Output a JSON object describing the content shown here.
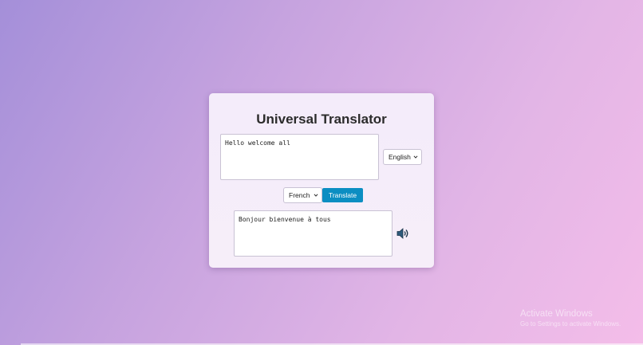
{
  "app": {
    "title": "Universal Translator"
  },
  "source": {
    "text": "Hello welcome all",
    "language": "English"
  },
  "target": {
    "language": "French",
    "text": "Bonjour bienvenue à tous"
  },
  "actions": {
    "translate_label": "Translate",
    "speak_icon": "speaker-icon"
  },
  "watermark": {
    "title": "Activate Windows",
    "subtitle": "Go to Settings to activate Windows."
  },
  "colors": {
    "button": "#0b8ec2",
    "card": "#f4ecfa"
  }
}
